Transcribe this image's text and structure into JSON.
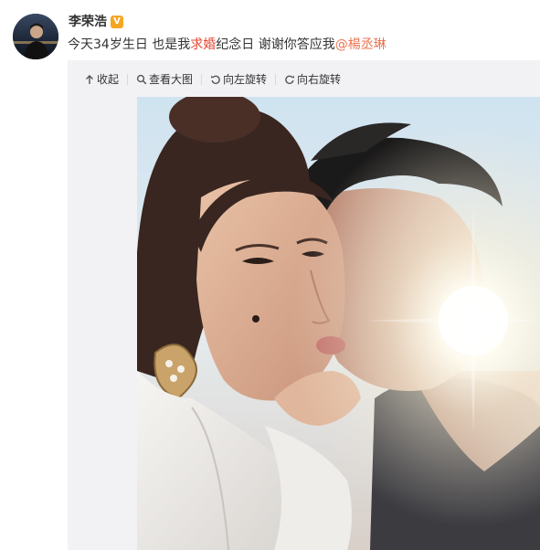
{
  "post": {
    "author": {
      "name": "李荣浩",
      "avatar_icon": "avatar-photo",
      "verified_icon": "verified-v-badge",
      "verified_label": "V",
      "verified_color": "#f5a623"
    },
    "text_parts": {
      "part1": "今天34岁生日 也是我",
      "part2": "求婚",
      "part3": "纪念日 谢谢你答应我",
      "mention": "@楊丞琳"
    }
  },
  "media_toolbar": {
    "collapse": {
      "label": "收起",
      "icon": "arrow-up-icon"
    },
    "view_large": {
      "label": "查看大图",
      "icon": "magnifier-icon"
    },
    "rotate_left": {
      "label": "向左旋转",
      "icon": "rotate-left-icon"
    },
    "rotate_right": {
      "label": "向右旋转",
      "icon": "rotate-right-icon"
    }
  },
  "photo": {
    "description_icon": "couple-selfie-photo"
  },
  "colors": {
    "mention": "#eb7350",
    "highlight": "#e2452f",
    "media_bg": "#f2f2f5"
  }
}
